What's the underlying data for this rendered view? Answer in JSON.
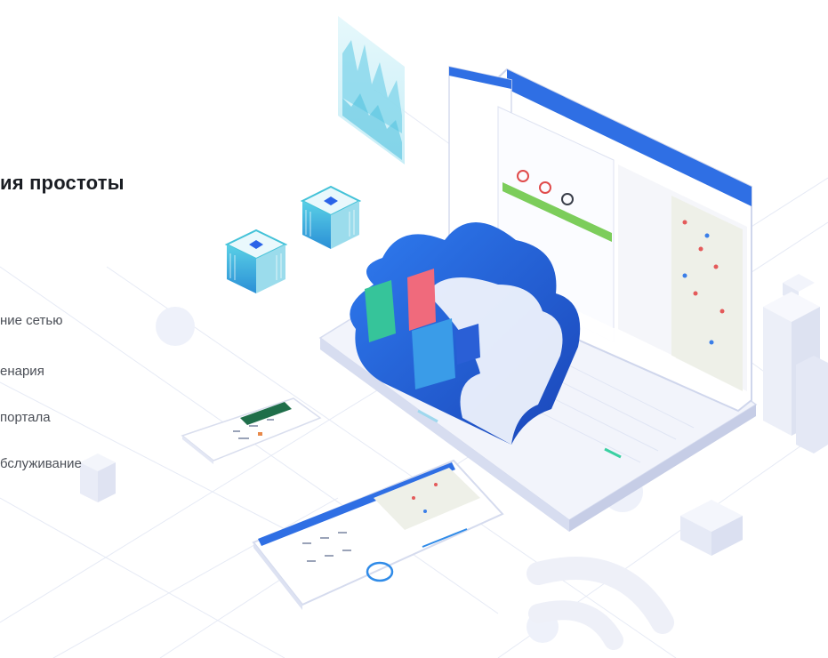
{
  "headline": "ия простоты",
  "features": [
    "ние сетью",
    "енария",
    "портала",
    "бслуживание"
  ]
}
